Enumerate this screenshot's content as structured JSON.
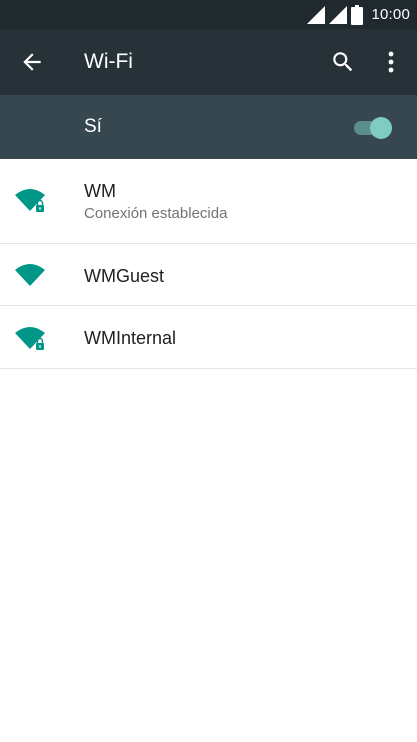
{
  "status_bar": {
    "time": "10:00",
    "icons": [
      "signal-icon",
      "signal-icon",
      "battery-icon"
    ]
  },
  "toolbar": {
    "title": "Wi-Fi",
    "back_icon": "arrow-left-icon",
    "search_icon": "search-icon",
    "overflow_icon": "more-vertical-icon"
  },
  "master_switch": {
    "label": "Sí",
    "on": true
  },
  "networks": [
    {
      "name": "WM",
      "status": "Conexión establecida",
      "secured": true,
      "icon": "wifi-lock-icon"
    },
    {
      "name": "WMGuest",
      "status": "",
      "secured": false,
      "icon": "wifi-icon"
    },
    {
      "name": "WMInternal",
      "status": "",
      "secured": true,
      "icon": "wifi-lock-icon"
    }
  ],
  "colors": {
    "status_bar": "#1f292e",
    "toolbar": "#263238",
    "switch_bar": "#37474f",
    "accent": "#009688",
    "toggle_thumb": "#80cbc4"
  }
}
